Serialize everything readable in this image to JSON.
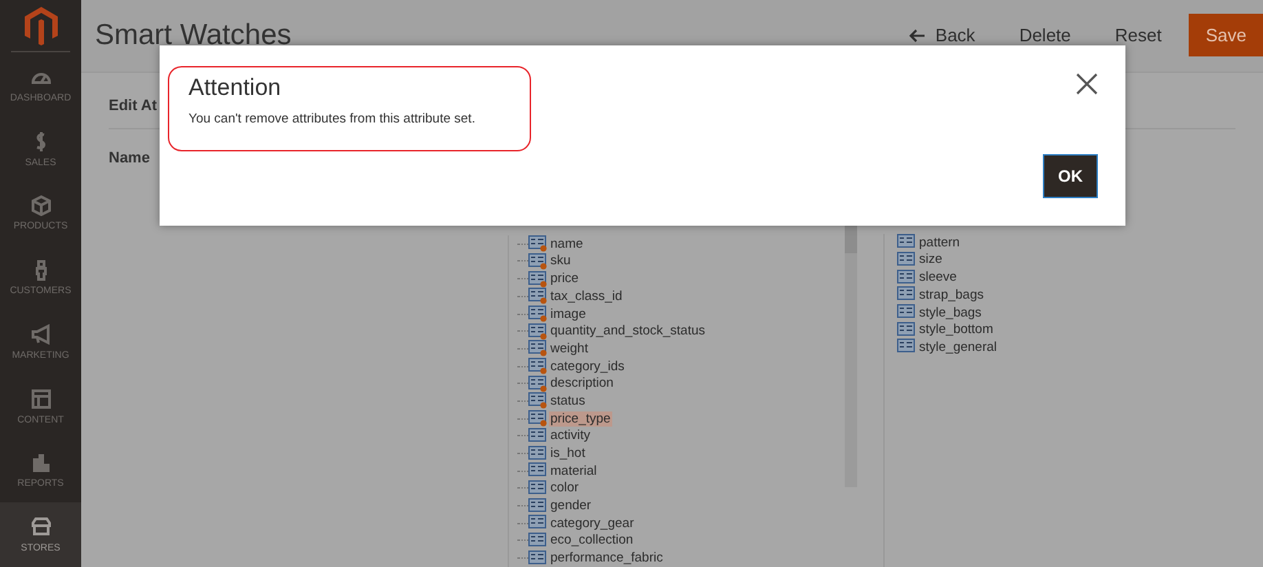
{
  "sidebar": {
    "items": [
      {
        "label": "DASHBOARD",
        "selected": false
      },
      {
        "label": "SALES",
        "selected": false
      },
      {
        "label": "PRODUCTS",
        "selected": false
      },
      {
        "label": "CUSTOMERS",
        "selected": false
      },
      {
        "label": "MARKETING",
        "selected": false
      },
      {
        "label": "CONTENT",
        "selected": false
      },
      {
        "label": "REPORTS",
        "selected": false
      },
      {
        "label": "STORES",
        "selected": true
      }
    ]
  },
  "header": {
    "title": "Smart Watches",
    "actions": [
      {
        "label": "Back",
        "kind": "back"
      },
      {
        "label": "Delete",
        "kind": "plain"
      },
      {
        "label": "Reset",
        "kind": "plain"
      },
      {
        "label": "Save",
        "kind": "primary"
      }
    ]
  },
  "section": {
    "title": "Edit At",
    "name_label": "Name"
  },
  "groups_tree": {
    "items": [
      {
        "label": "name",
        "kind": "system",
        "selected": false
      },
      {
        "label": "sku",
        "kind": "system",
        "selected": false
      },
      {
        "label": "price",
        "kind": "system",
        "selected": false
      },
      {
        "label": "tax_class_id",
        "kind": "system",
        "selected": false
      },
      {
        "label": "image",
        "kind": "system",
        "selected": false
      },
      {
        "label": "quantity_and_stock_status",
        "kind": "system",
        "selected": false
      },
      {
        "label": "weight",
        "kind": "system",
        "selected": false
      },
      {
        "label": "category_ids",
        "kind": "system",
        "selected": false
      },
      {
        "label": "description",
        "kind": "system",
        "selected": false
      },
      {
        "label": "status",
        "kind": "system",
        "selected": false
      },
      {
        "label": "price_type",
        "kind": "system",
        "selected": true
      },
      {
        "label": "activity",
        "kind": "user",
        "selected": false
      },
      {
        "label": "is_hot",
        "kind": "user",
        "selected": false
      },
      {
        "label": "material",
        "kind": "user",
        "selected": false
      },
      {
        "label": "color",
        "kind": "user",
        "selected": false
      },
      {
        "label": "gender",
        "kind": "user",
        "selected": false
      },
      {
        "label": "category_gear",
        "kind": "user",
        "selected": false
      },
      {
        "label": "eco_collection",
        "kind": "user",
        "selected": false
      },
      {
        "label": "performance_fabric",
        "kind": "user",
        "selected": false
      }
    ]
  },
  "unassigned": {
    "items": [
      {
        "label": "pattern"
      },
      {
        "label": "size"
      },
      {
        "label": "sleeve"
      },
      {
        "label": "strap_bags"
      },
      {
        "label": "style_bags"
      },
      {
        "label": "style_bottom"
      },
      {
        "label": "style_general"
      }
    ]
  },
  "modal": {
    "title": "Attention",
    "message": "You can't remove attributes from this attribute set.",
    "button": "OK"
  }
}
